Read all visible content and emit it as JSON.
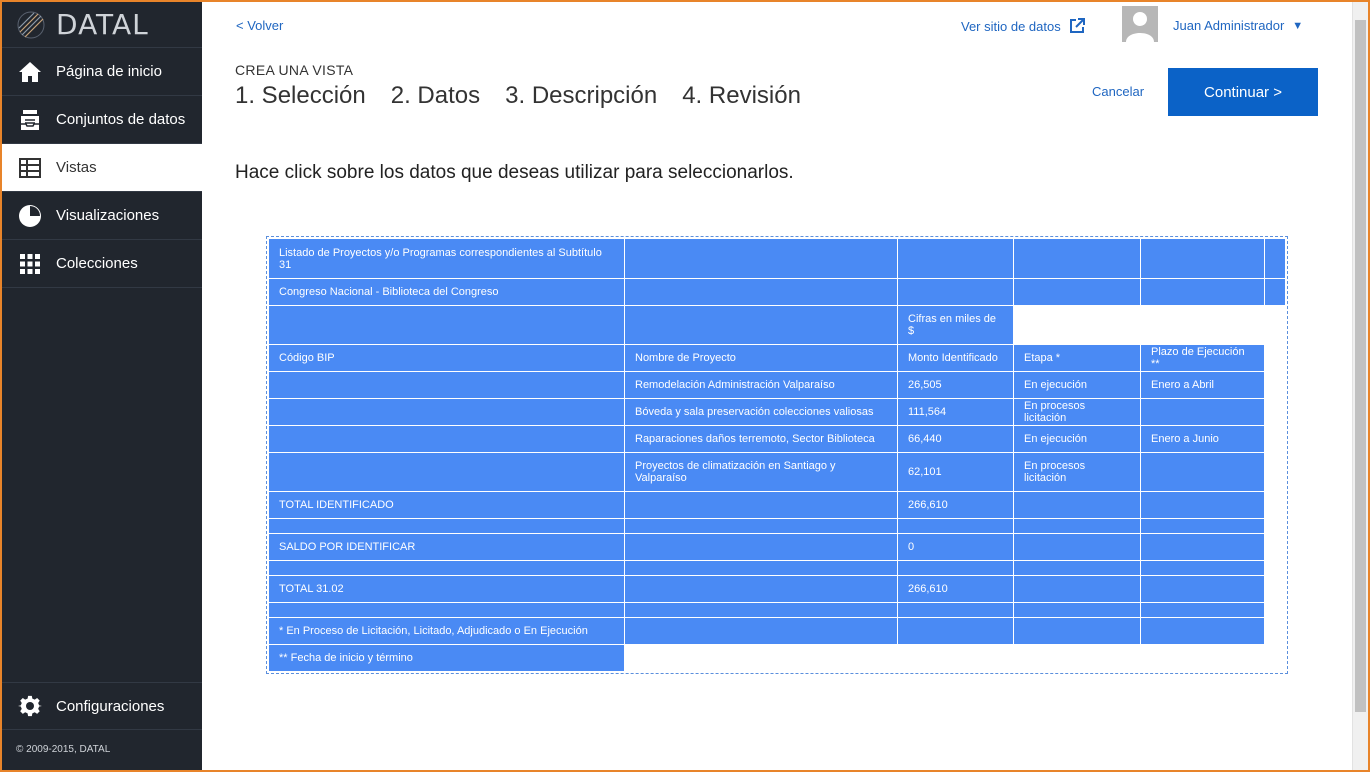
{
  "app": {
    "logo_text": "DATAL",
    "copyright": "© 2009-2015, DATAL",
    "accent_color": "#0b62c7",
    "cell_color": "#4a8af4",
    "sidebar_color": "#21262e"
  },
  "sidebar": {
    "items": [
      {
        "label": "Página de inicio",
        "icon": "home-icon"
      },
      {
        "label": "Conjuntos de datos",
        "icon": "inbox-icon"
      },
      {
        "label": "Vistas",
        "icon": "table-icon"
      },
      {
        "label": "Visualizaciones",
        "icon": "pie-chart-icon"
      },
      {
        "label": "Colecciones",
        "icon": "grid-icon"
      }
    ],
    "config_label": "Configuraciones"
  },
  "header": {
    "back": "< Volver",
    "external_link": "Ver sitio de datos",
    "user": "Juan Administrador",
    "caret": "▼"
  },
  "wizard": {
    "kicker": "CREA UNA VISTA",
    "steps": [
      "1. Selección",
      "2. Datos",
      "3. Descripción",
      "4. Revisión"
    ],
    "cancel": "Cancelar",
    "continue": "Continuar >"
  },
  "instruction": "Hace click sobre los datos que deseas utilizar para seleccionarlos.",
  "table": {
    "rows": [
      [
        "Listado de Proyectos y/o Programas correspondientes al Subtítulo 31",
        "",
        "",
        "",
        "",
        ""
      ],
      [
        "Congreso Nacional - Biblioteca del Congreso",
        "",
        "",
        "",
        "",
        ""
      ],
      [
        "",
        "",
        "Cifras en miles de $"
      ],
      [
        "Código BIP",
        "Nombre de Proyecto",
        "Monto Identificado",
        "Etapa *",
        "Plazo de Ejecución **"
      ],
      [
        "",
        "Remodelación Administración Valparaíso",
        "26,505",
        "En ejecución",
        "Enero a Abril"
      ],
      [
        "",
        "Bóveda y sala preservación colecciones valiosas",
        "111,564",
        "En procesos licitación",
        ""
      ],
      [
        "",
        "Raparaciones daños terremoto, Sector Biblioteca",
        "66,440",
        "En ejecución",
        "Enero a Junio"
      ],
      [
        "",
        "Proyectos de climatización en Santiago y Valparaíso",
        "62,101",
        "En procesos licitación",
        ""
      ],
      [
        "TOTAL IDENTIFICADO",
        "",
        "266,610",
        "",
        ""
      ],
      [
        "",
        "",
        "",
        "",
        ""
      ],
      [
        "SALDO POR IDENTIFICAR",
        "",
        "0",
        "",
        ""
      ],
      [
        "",
        "",
        "",
        "",
        ""
      ],
      [
        "TOTAL 31.02",
        "",
        "266,610",
        "",
        ""
      ],
      [
        "",
        "",
        "",
        "",
        ""
      ],
      [
        "* En Proceso de Licitación, Licitado, Adjudicado o En Ejecución",
        "",
        "",
        "",
        ""
      ],
      [
        "** Fecha de inicio y término"
      ]
    ]
  }
}
